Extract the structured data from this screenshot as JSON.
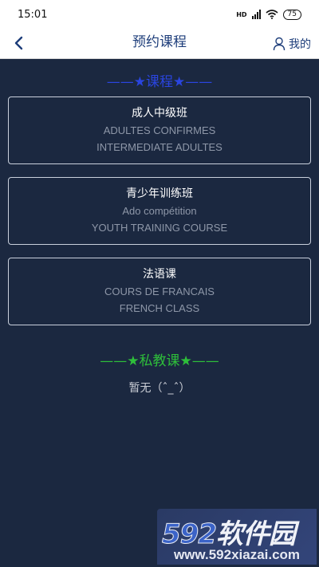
{
  "status_bar": {
    "time": "15:01",
    "network": "HD",
    "battery": "75"
  },
  "header": {
    "title": "预约课程",
    "mine_label": "我的"
  },
  "courses_section": {
    "heading": "——★课程★——",
    "items": [
      {
        "title": "成人中级班",
        "subtitle_fr": "ADULTES CONFIRMES",
        "subtitle_en": "INTERMEDIATE ADULTES"
      },
      {
        "title": "青少年训练班",
        "subtitle_fr": "Ado compétition",
        "subtitle_en": "YOUTH TRAINING COURSE"
      },
      {
        "title": "法语课",
        "subtitle_fr": "COURS DE FRANCAIS",
        "subtitle_en": "FRENCH CLASS"
      }
    ]
  },
  "private_section": {
    "heading": "——★私教课★——",
    "empty_text": "暂无（ˆ_ˆ）"
  },
  "watermark": {
    "logo_number": "592",
    "logo_text": "软件园",
    "url": "www.592xiazai.com"
  },
  "colors": {
    "background": "#1b2840",
    "courses_heading": "#2a45e0",
    "private_heading": "#2ebf3a",
    "header_text": "#1d3d7a"
  }
}
